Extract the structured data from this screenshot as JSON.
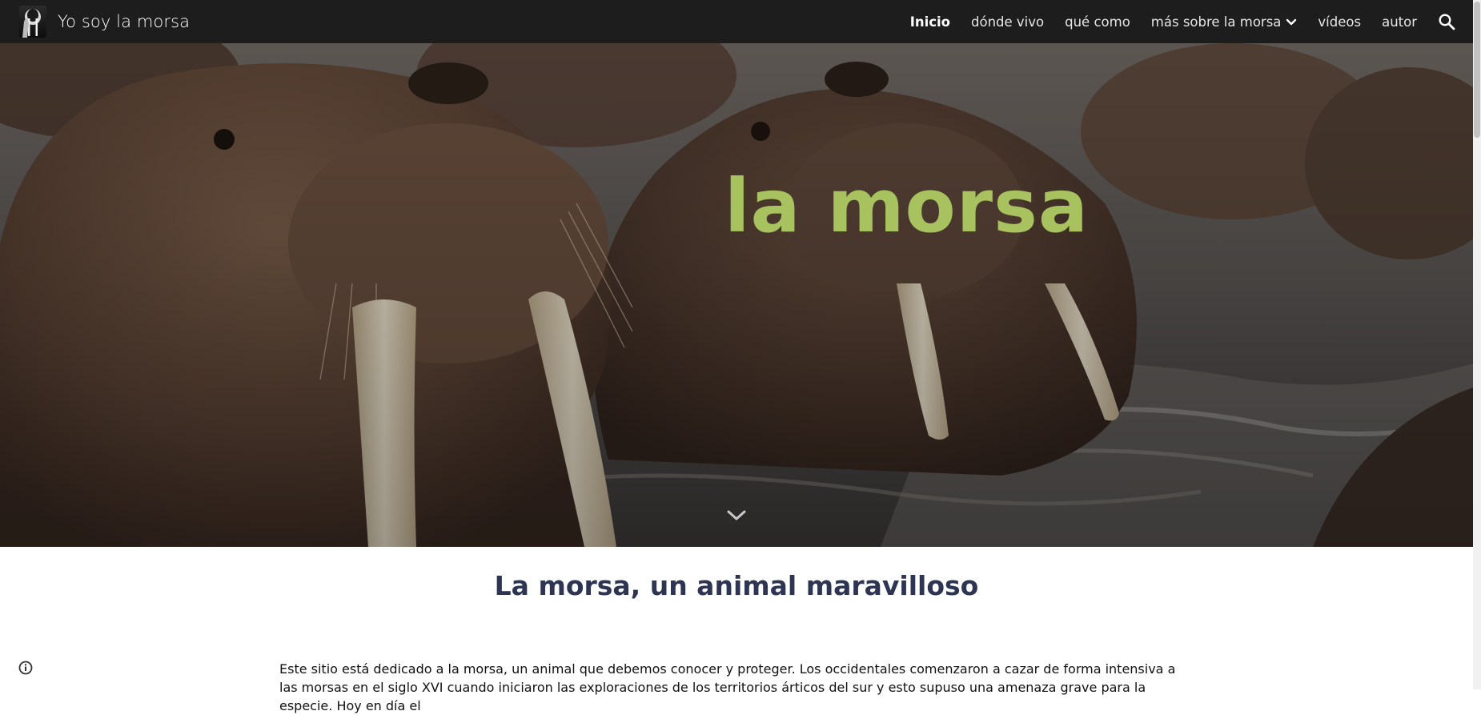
{
  "header": {
    "site_title": "Yo soy la morsa",
    "logo_icon": "walrus-logo-icon",
    "nav": [
      {
        "label": "Inicio",
        "active": true
      },
      {
        "label": "dónde vivo",
        "active": false
      },
      {
        "label": "qué como",
        "active": false
      },
      {
        "label": "más sobre la morsa",
        "active": false,
        "has_dropdown": true
      },
      {
        "label": "vídeos",
        "active": false
      },
      {
        "label": "autor",
        "active": false
      }
    ],
    "search_icon": "search-icon",
    "dropdown_icon": "chevron-down-icon"
  },
  "hero": {
    "title": "la morsa",
    "title_color": "#a7c25e",
    "scroll_icon": "chevron-down-icon"
  },
  "main": {
    "heading": "La morsa, un animal maravilloso",
    "heading_color": "#2d3553",
    "paragraph": "Este sitio está dedicado a la morsa, un animal que debemos conocer y proteger. Los occidentales comenzaron a cazar de forma intensiva a las morsas en el siglo XVI cuando iniciaron las exploraciones de los territorios árticos del sur y esto supuso una amenaza grave para la especie. Hoy en día el"
  },
  "footer": {
    "info_icon": "info-icon"
  },
  "colors": {
    "topbar": "#1d1d1d",
    "nav_text": "#e6e6e6"
  }
}
